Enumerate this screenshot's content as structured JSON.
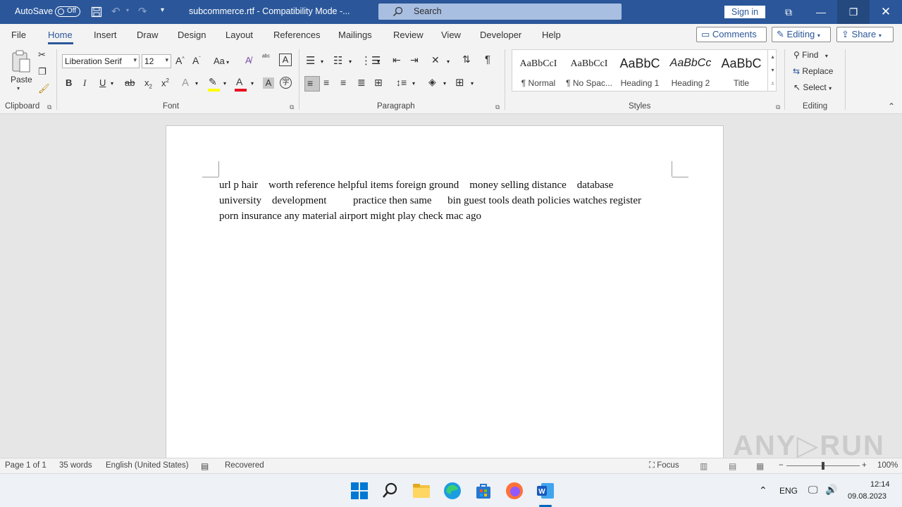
{
  "titlebar": {
    "autosave_label": "AutoSave",
    "autosave_state": "Off",
    "doc_title": "subcommerce.rtf  -  Compatibility Mode  -...",
    "search_placeholder": "Search",
    "signin_label": "Sign in"
  },
  "menu": {
    "tabs": [
      "File",
      "Home",
      "Insert",
      "Draw",
      "Design",
      "Layout",
      "References",
      "Mailings",
      "Review",
      "View",
      "Developer",
      "Help"
    ],
    "active_tab": "Home",
    "comments_label": "Comments",
    "editing_label": "Editing",
    "share_label": "Share"
  },
  "ribbon": {
    "clipboard": {
      "paste_label": "Paste",
      "group_label": "Clipboard"
    },
    "font": {
      "font_name": "Liberation Serif",
      "font_size": "12",
      "case_label": "Aa",
      "group_label": "Font"
    },
    "paragraph": {
      "group_label": "Paragraph"
    },
    "styles": {
      "group_label": "Styles",
      "items": [
        {
          "preview": "AaBbCcI",
          "name": "¶ Normal"
        },
        {
          "preview": "AaBbCcI",
          "name": "¶ No Spac..."
        },
        {
          "preview": "AaBbC",
          "name": "Heading 1"
        },
        {
          "preview": "AaBbCc",
          "name": "Heading 2"
        },
        {
          "preview": "AaBbC",
          "name": "Title"
        }
      ]
    },
    "editing": {
      "find_label": "Find",
      "replace_label": "Replace",
      "select_label": "Select",
      "group_label": "Editing"
    }
  },
  "document": {
    "lines": [
      "url p hair    worth reference helpful items foreign ground    money selling distance    database",
      "university    development          practice then same      bin guest tools death policies watches register",
      "porn insurance any material airport might play check mac ago"
    ]
  },
  "status": {
    "page": "Page 1 of 1",
    "words": "35 words",
    "language": "English (United States)",
    "recovered": "Recovered",
    "focus": "Focus",
    "zoom": "100%"
  },
  "taskbar": {
    "lang": "ENG",
    "time": "12:14",
    "date": "09.08.2023"
  },
  "colors": {
    "accent": "#2b579a",
    "ribbon_bg": "#f3f3f3",
    "canvas_bg": "#e6e6e6"
  }
}
